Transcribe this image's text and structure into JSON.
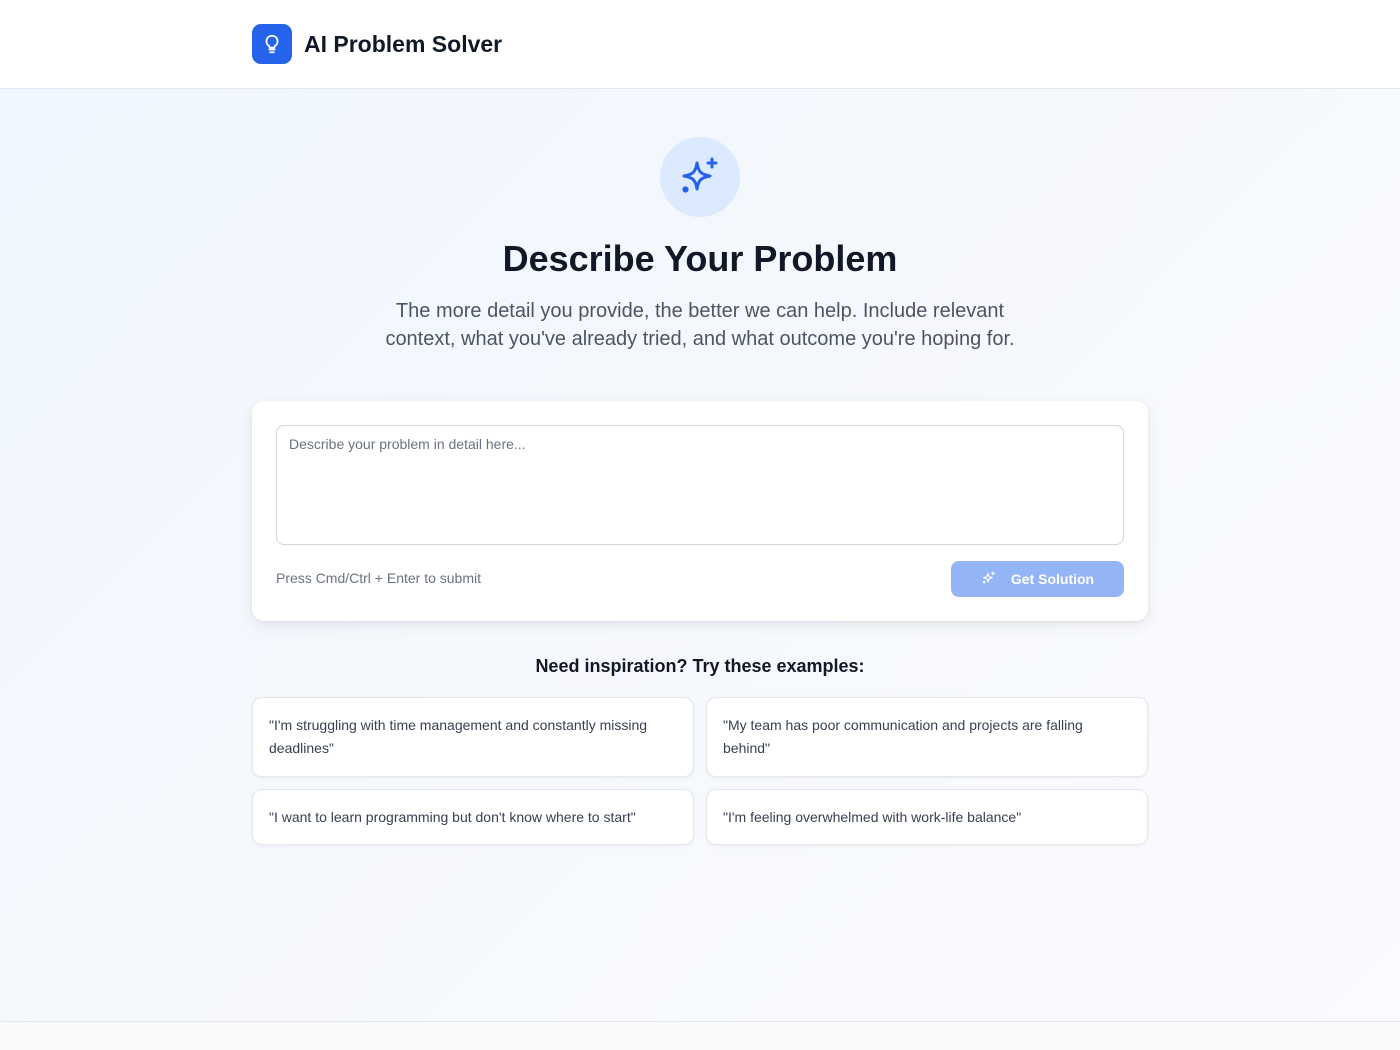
{
  "header": {
    "title": "AI Problem Solver",
    "logo_icon": "lightbulb-icon"
  },
  "hero": {
    "icon": "sparkles-icon",
    "title": "Describe Your Problem",
    "subtitle": "The more detail you provide, the better we can help. Include relevant context, what you've already tried, and what outcome you're hoping for."
  },
  "form": {
    "placeholder": "Describe your problem in detail here...",
    "value": "",
    "hint": "Press Cmd/Ctrl + Enter to submit",
    "submit_label": "Get Solution",
    "submit_icon": "sparkles-icon"
  },
  "examples": {
    "title": "Need inspiration? Try these examples:",
    "items": [
      "\"I'm struggling with time management and constantly missing deadlines\"",
      "\"My team has poor communication and projects are falling behind\"",
      "\"I want to learn programming but don't know where to start\"",
      "\"I'm feeling overwhelmed with work-life balance\""
    ]
  },
  "colors": {
    "accent": "#2563eb",
    "accent_light": "#dbeafe",
    "button_disabled": "#93b4f5",
    "text_primary": "#111827",
    "text_secondary": "#4b5563"
  }
}
